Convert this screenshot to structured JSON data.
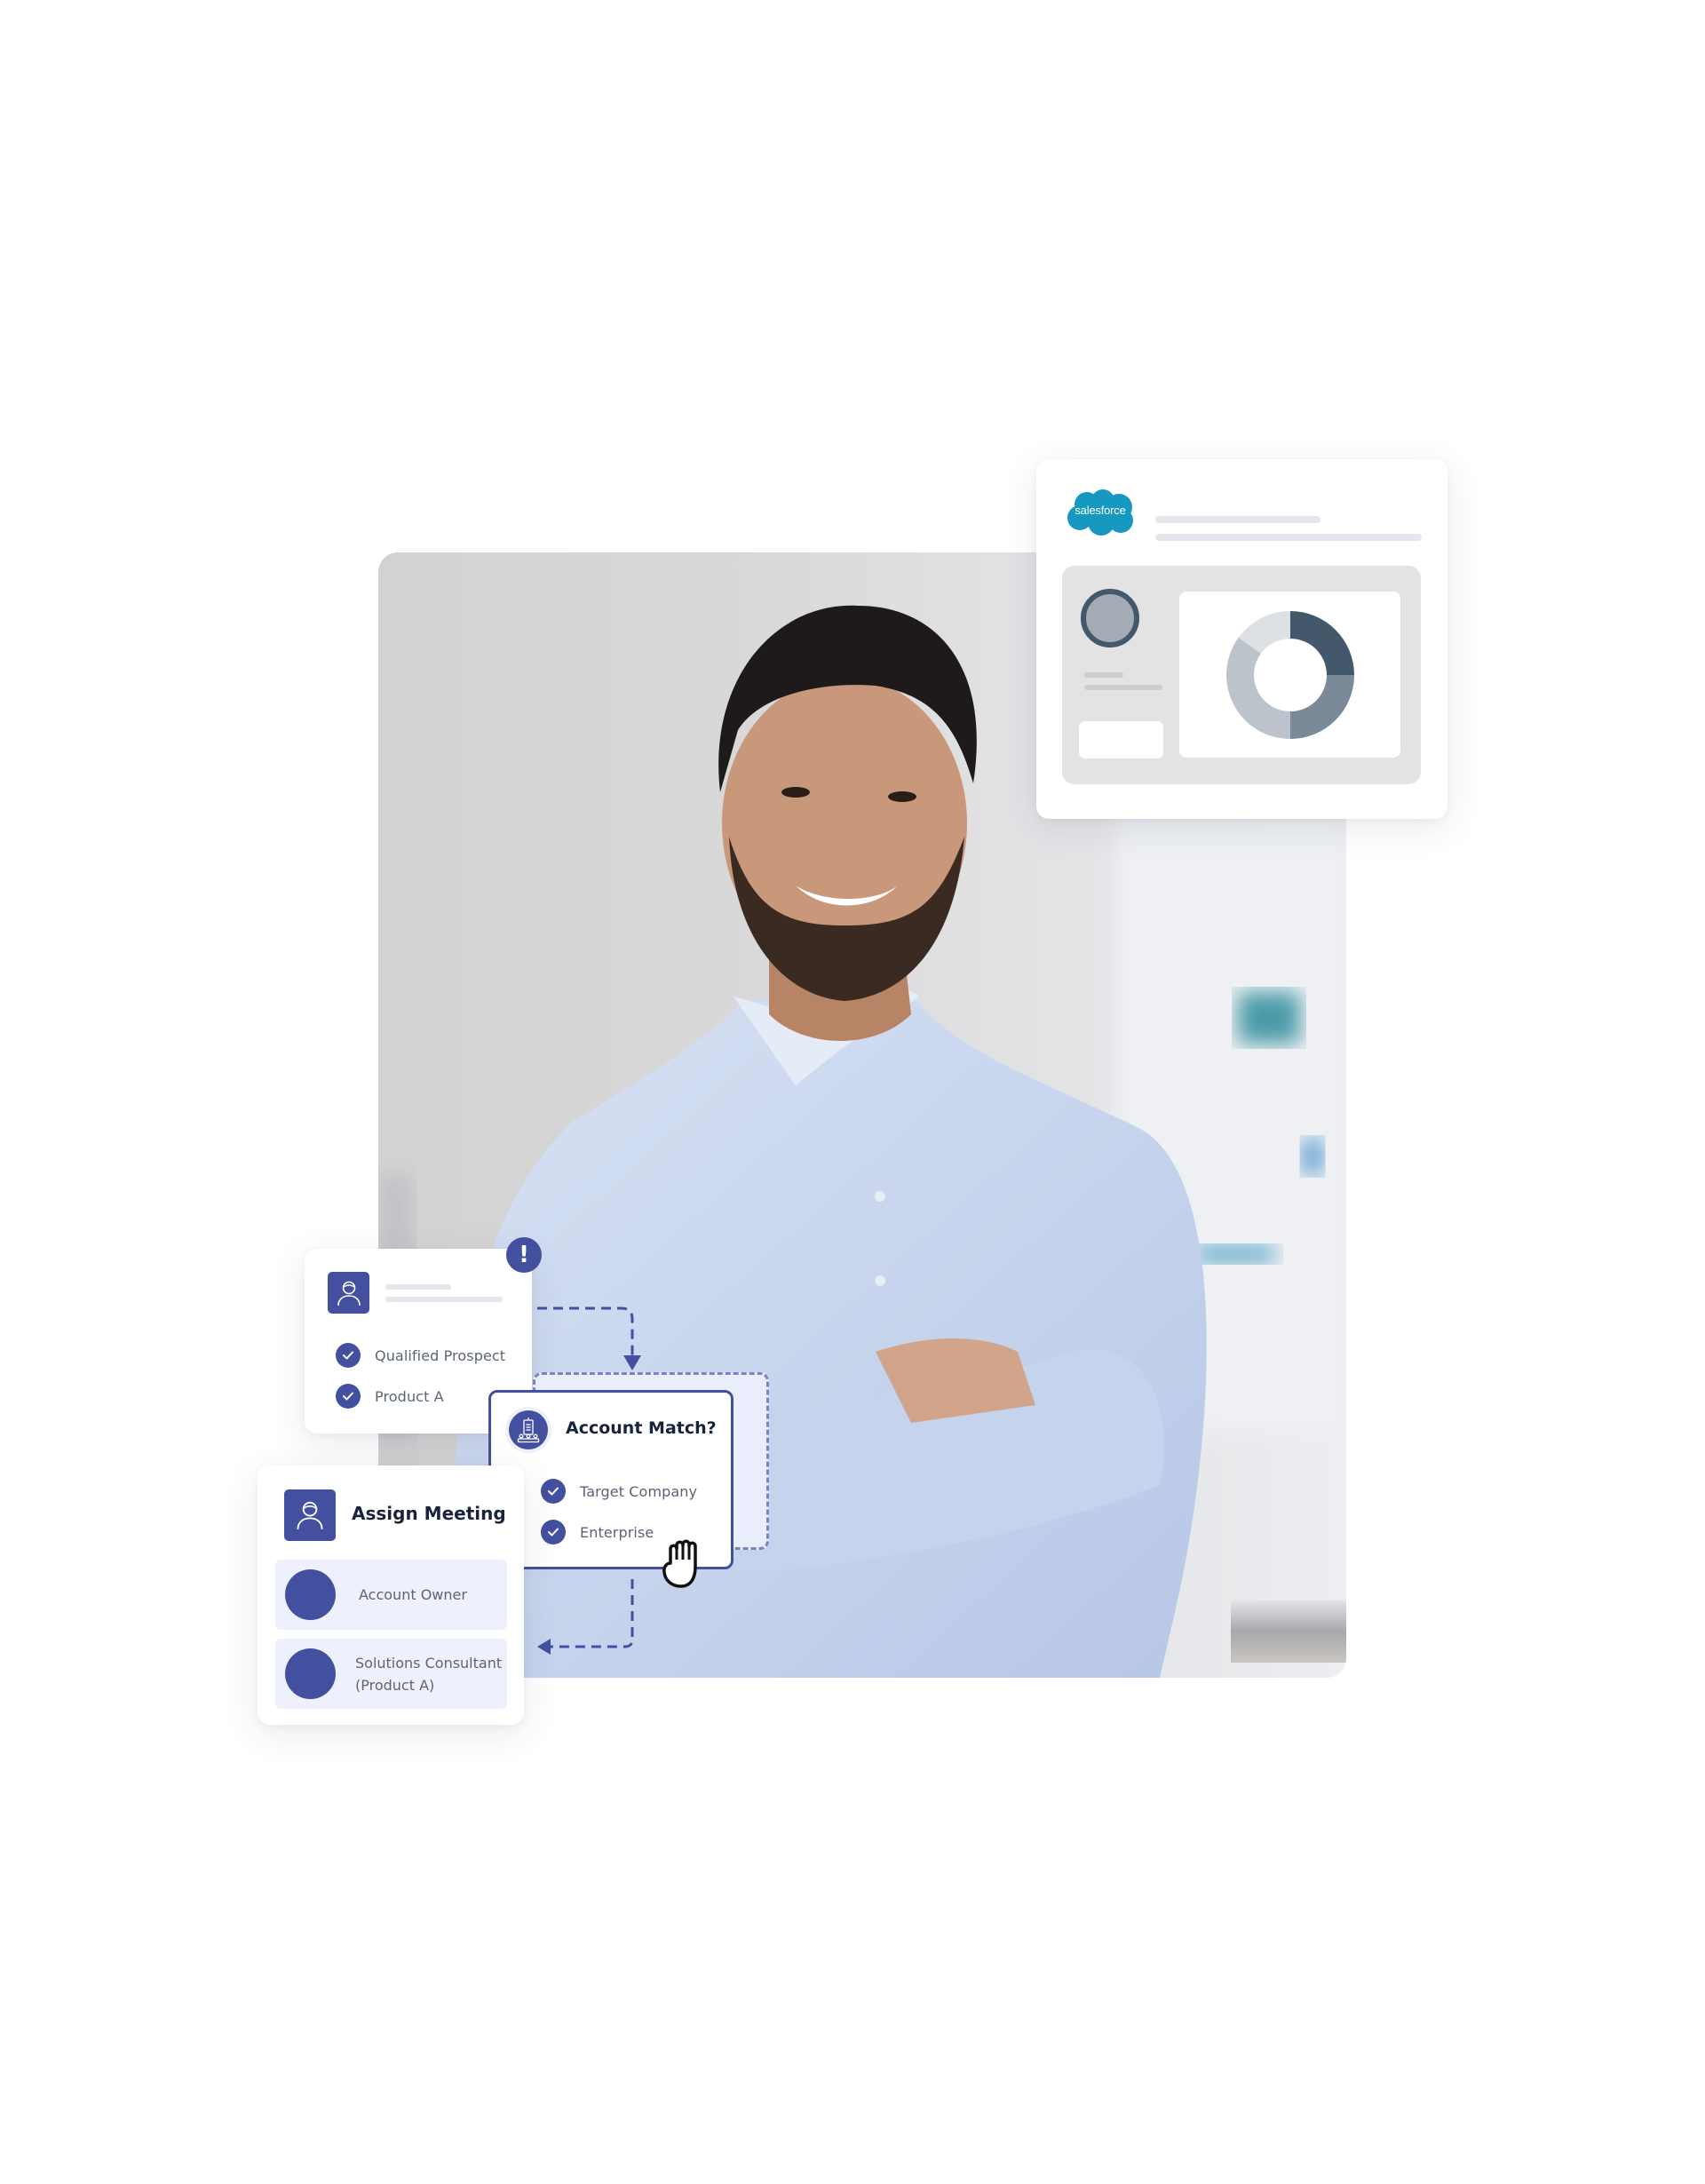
{
  "salesforce_card": {
    "logo_text": "salesforce",
    "brand_color": "#1798c1",
    "donut": {
      "segments": [
        {
          "name": "dark",
          "fraction": 0.25,
          "color": "#43586b"
        },
        {
          "name": "mid",
          "fraction": 0.25,
          "color": "#7b8a98"
        },
        {
          "name": "light",
          "fraction": 0.35,
          "color": "#bcc3ca"
        },
        {
          "name": "lightest",
          "fraction": 0.15,
          "color": "#dde1e4"
        }
      ]
    }
  },
  "qualify_card": {
    "alert_symbol": "!",
    "checks": [
      {
        "label": "Qualified Prospect"
      },
      {
        "label": "Product A"
      }
    ]
  },
  "account_match_card": {
    "title": "Account Match?",
    "checks": [
      {
        "label": "Target Company"
      },
      {
        "label": "Enterprise"
      }
    ]
  },
  "assign_meeting_card": {
    "title": "Assign Meeting",
    "assignees": [
      {
        "label": "Account Owner"
      },
      {
        "label": "Solutions Consultant (Product A)"
      }
    ]
  },
  "colors": {
    "accent": "#4350a0",
    "title_text": "#17243b",
    "body_text": "#5c6574",
    "item_bg": "#eef1fd"
  }
}
